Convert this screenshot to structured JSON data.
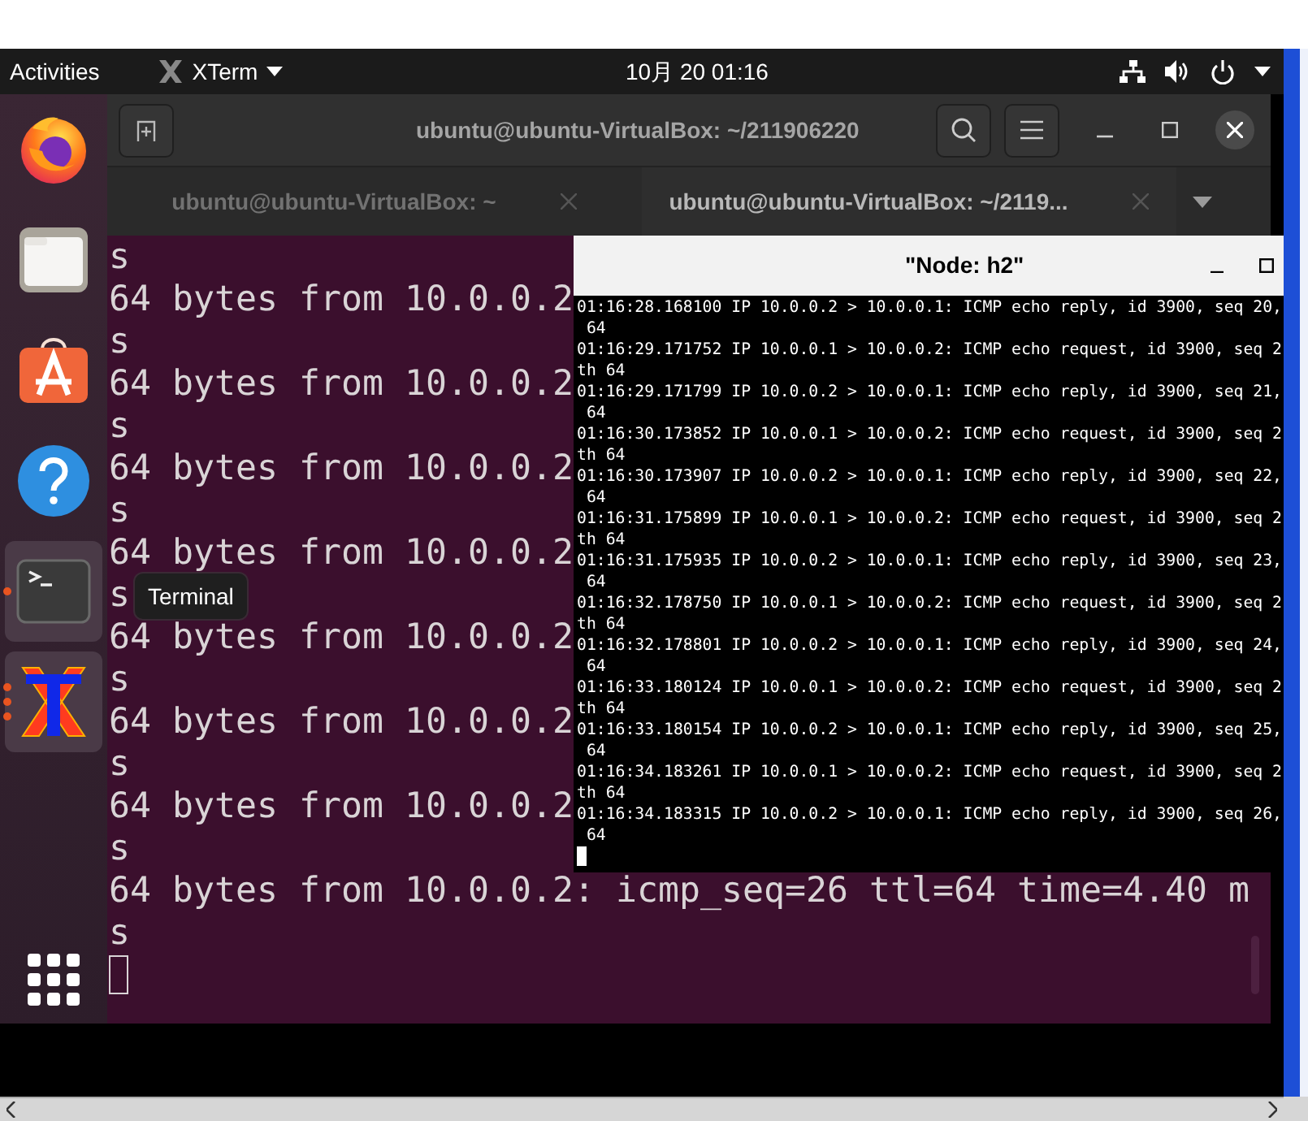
{
  "top_bar": {
    "activities": "Activities",
    "app_menu": "XTerm",
    "clock": "10月 20 01:16"
  },
  "dock": {
    "items": [
      {
        "kind": "firefox",
        "highlighted": false,
        "running": false
      },
      {
        "kind": "files",
        "highlighted": false,
        "running": false
      },
      {
        "kind": "software",
        "highlighted": false,
        "running": false
      },
      {
        "kind": "help",
        "highlighted": false,
        "running": false
      },
      {
        "kind": "terminal",
        "highlighted": true,
        "running": true,
        "multiple_windows": false
      },
      {
        "kind": "xterm",
        "highlighted": true,
        "running": true,
        "multiple_windows": true
      }
    ]
  },
  "tooltip": "Terminal",
  "terminal_window": {
    "title": "ubuntu@ubuntu-VirtualBox: ~/211906220",
    "tabs": [
      {
        "label": "ubuntu@ubuntu-VirtualBox: ~",
        "selected": false
      },
      {
        "label": "ubuntu@ubuntu-VirtualBox: ~/2119...",
        "selected": true
      }
    ],
    "lines": [
      "s",
      "64 bytes from 10.0.0.2",
      "s",
      "64 bytes from 10.0.0.2",
      "s",
      "64 bytes from 10.0.0.2",
      "s",
      "64 bytes from 10.0.0.2",
      "s",
      "64 bytes from 10.0.0.2",
      "s",
      "64 bytes from 10.0.0.2",
      "s",
      "64 bytes from 10.0.0.2",
      "s",
      "64 bytes from 10.0.0.2: icmp_seq=26 ttl=64 time=4.40 m",
      "s"
    ]
  },
  "xterm_window": {
    "title": "\"Node: h2\"",
    "lines": [
      "01:16:28.168100 IP 10.0.0.2 > 10.0.0.1: ICMP echo reply, id 3900, seq 20,",
      " 64",
      "01:16:29.171752 IP 10.0.0.1 > 10.0.0.2: ICMP echo request, id 3900, seq 2",
      "th 64",
      "01:16:29.171799 IP 10.0.0.2 > 10.0.0.1: ICMP echo reply, id 3900, seq 21,",
      " 64",
      "01:16:30.173852 IP 10.0.0.1 > 10.0.0.2: ICMP echo request, id 3900, seq 2",
      "th 64",
      "01:16:30.173907 IP 10.0.0.2 > 10.0.0.1: ICMP echo reply, id 3900, seq 22,",
      " 64",
      "01:16:31.175899 IP 10.0.0.1 > 10.0.0.2: ICMP echo request, id 3900, seq 2",
      "th 64",
      "01:16:31.175935 IP 10.0.0.2 > 10.0.0.1: ICMP echo reply, id 3900, seq 23,",
      " 64",
      "01:16:32.178750 IP 10.0.0.1 > 10.0.0.2: ICMP echo request, id 3900, seq 2",
      "th 64",
      "01:16:32.178801 IP 10.0.0.2 > 10.0.0.1: ICMP echo reply, id 3900, seq 24,",
      " 64",
      "01:16:33.180124 IP 10.0.0.1 > 10.0.0.2: ICMP echo request, id 3900, seq 2",
      "th 64",
      "01:16:33.180154 IP 10.0.0.2 > 10.0.0.1: ICMP echo reply, id 3900, seq 25,",
      " 64",
      "01:16:34.183261 IP 10.0.0.1 > 10.0.0.2: ICMP echo request, id 3900, seq 2",
      "th 64",
      "01:16:34.183315 IP 10.0.0.2 > 10.0.0.1: ICMP echo reply, id 3900, seq 26,",
      " 64"
    ]
  }
}
